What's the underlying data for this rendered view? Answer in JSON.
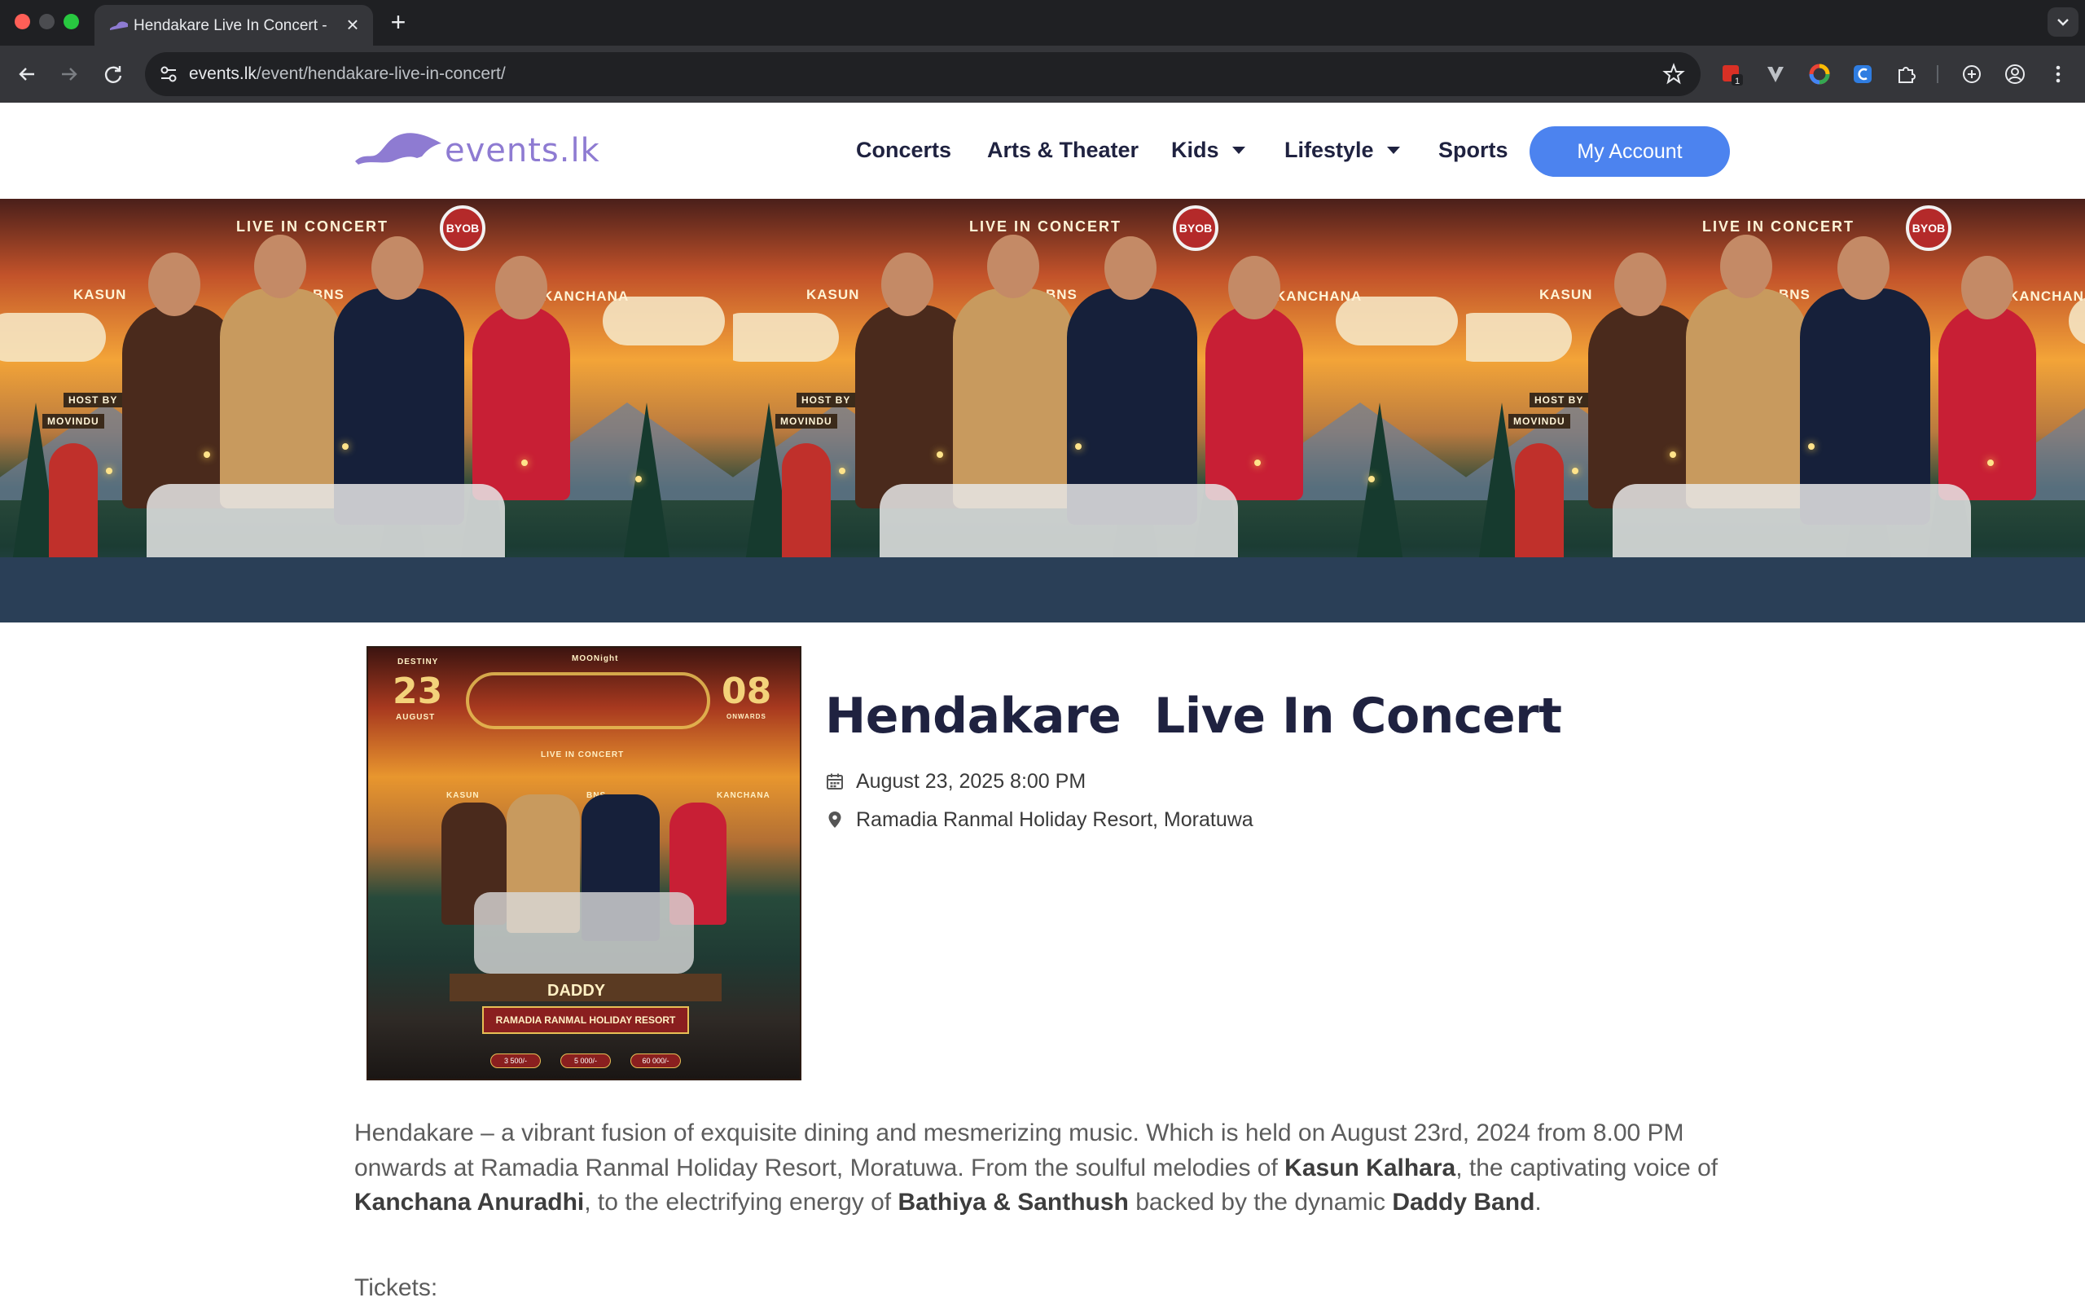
{
  "browser": {
    "tab_title": "Hendakare  Live In Concert - ",
    "url_host": "events.lk",
    "url_path": "/event/hendakare-live-in-concert/",
    "extension_badge": "1"
  },
  "site": {
    "logo_text": "events.lk",
    "nav": {
      "concerts": "Concerts",
      "arts_theater": "Arts & Theater",
      "kids": "Kids",
      "lifestyle": "Lifestyle",
      "sports": "Sports",
      "account": "My Account"
    }
  },
  "banner": {
    "headline": "LIVE IN CONCERT",
    "badge": "BYOB",
    "artists": [
      "KASUN",
      "BNS",
      "KANCHANA"
    ],
    "host_sign": "HOST BY",
    "host_name": "MOVINDU"
  },
  "poster": {
    "day": "23",
    "month": "AUGUST",
    "venue_label": "DESTINY",
    "time": "08",
    "time_label": "ONWARDS",
    "brand": "MOONight",
    "subtitle": "LIVE IN CONCERT",
    "band": "DADDY",
    "venue_banner": "RAMADIA RANMAL HOLIDAY RESORT",
    "tickets": [
      "3 500/-",
      "5 000/-",
      "60 000/-"
    ]
  },
  "event": {
    "title": "Hendakare  Live In Concert",
    "datetime": "August 23, 2025 8:00 PM",
    "location": "Ramadia Ranmal Holiday Resort, Moratuwa",
    "description": {
      "p1": "Hendakare – a vibrant fusion of exquisite dining and mesmerizing music. Which is held on August 23rd, 2024 from 8.00 PM onwards at Ramadia Ranmal Holiday Resort, Moratuwa. From the soulful melodies of ",
      "b1": "Kasun Kalhara",
      "p2": ", the captivating voice of ",
      "b2": "Kanchana Anuradhi",
      "p3": ", to the electrifying energy of ",
      "b3": "Bathiya & Santhush",
      "p4": " backed by the dynamic ",
      "b4": "Daddy Band",
      "p5": "."
    },
    "tickets_heading": "Tickets:"
  },
  "colors": {
    "brand_purple": "#8e7bd2",
    "nav_text": "#1f2240",
    "account_button": "#4c83ef"
  },
  "icons": {
    "calendar": "calendar-icon",
    "location": "map-pin-icon"
  }
}
